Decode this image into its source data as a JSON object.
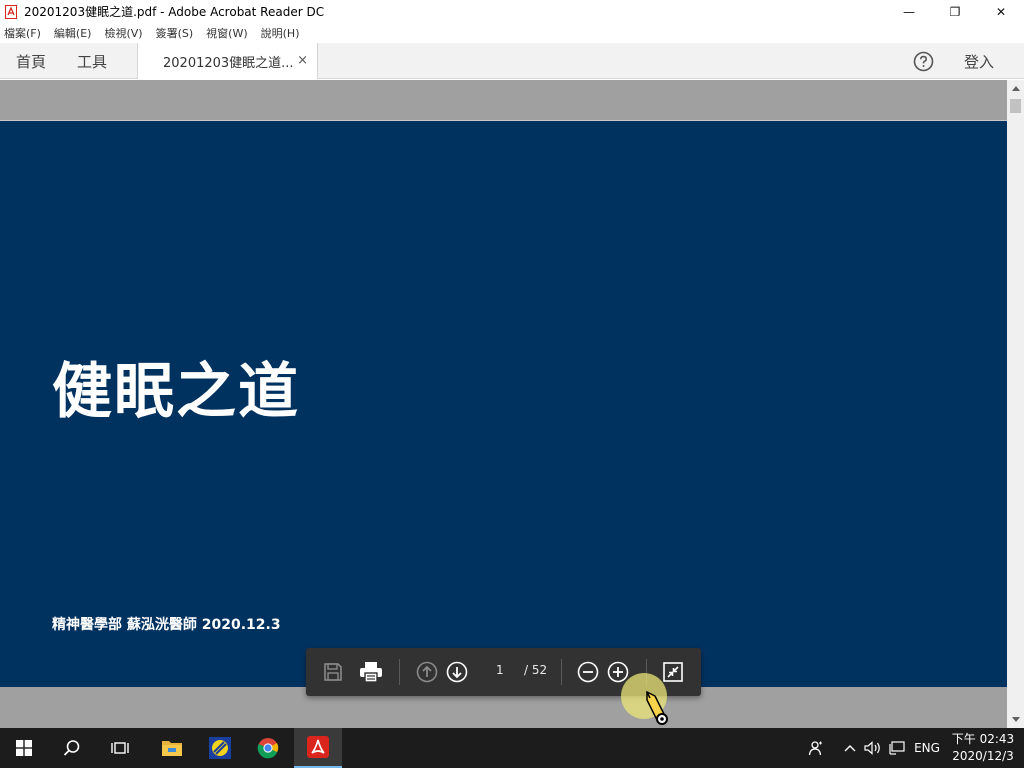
{
  "window": {
    "title": "20201203健眠之道.pdf - Adobe Acrobat Reader DC",
    "minimize_glyph": "—",
    "maximize_glyph": "❐",
    "close_glyph": "✕"
  },
  "menu": [
    {
      "label": "檔案(F)"
    },
    {
      "label": "編輯(E)"
    },
    {
      "label": "檢視(V)"
    },
    {
      "label": "簽署(S)"
    },
    {
      "label": "視窗(W)"
    },
    {
      "label": "說明(H)"
    }
  ],
  "tabs": {
    "home": "首頁",
    "tools": "工具",
    "document": "20201203健眠之道...",
    "close_glyph": "×",
    "signin": "登入"
  },
  "slide": {
    "title": "健眠之道",
    "subtitle": "精神醫學部 蘇泓洸醫師 2020.12.3",
    "background": "#003260"
  },
  "toolbar": {
    "current_page": "1",
    "total_pages": "/ 52"
  },
  "clock": {
    "time": "下午 02:43",
    "date": "2020/12/3"
  },
  "tray": {
    "language": "ENG",
    "chevron": "^"
  },
  "colors": {
    "accent": "#76b9ed",
    "acrobat_red": "#d9251c",
    "taskbar": "#1c1c1c"
  }
}
